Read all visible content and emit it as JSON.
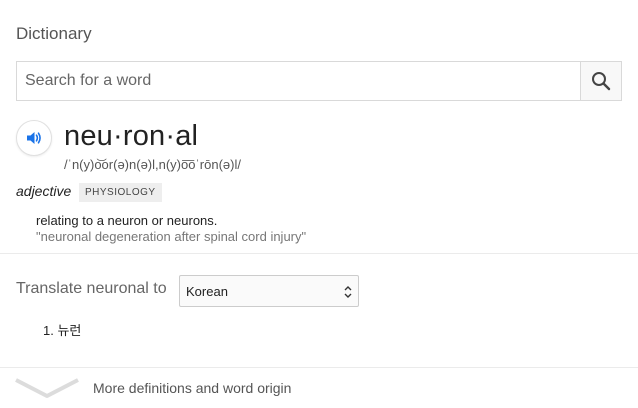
{
  "header": {
    "title": "Dictionary"
  },
  "search": {
    "placeholder": "Search for a word",
    "icon": "search-icon"
  },
  "entry": {
    "headword": "neu·ron·al",
    "phonetic": "/ˈn(y)o͝or(ə)n(ə)l,n(y)o͞oˈrōn(ə)l/",
    "part_of_speech": "adjective",
    "domain_tag": "PHYSIOLOGY",
    "definition": "relating to a neuron or neurons.",
    "example": "\"neuronal degeneration after spinal cord injury\""
  },
  "translate": {
    "label": "Translate neuronal to",
    "language": "Korean",
    "result_number": "1.",
    "result": "뉴런"
  },
  "footer": {
    "more_label": "More definitions and word origin"
  },
  "colors": {
    "accent": "#1a73e8",
    "divider": "#ebebeb",
    "muted": "#777777"
  }
}
